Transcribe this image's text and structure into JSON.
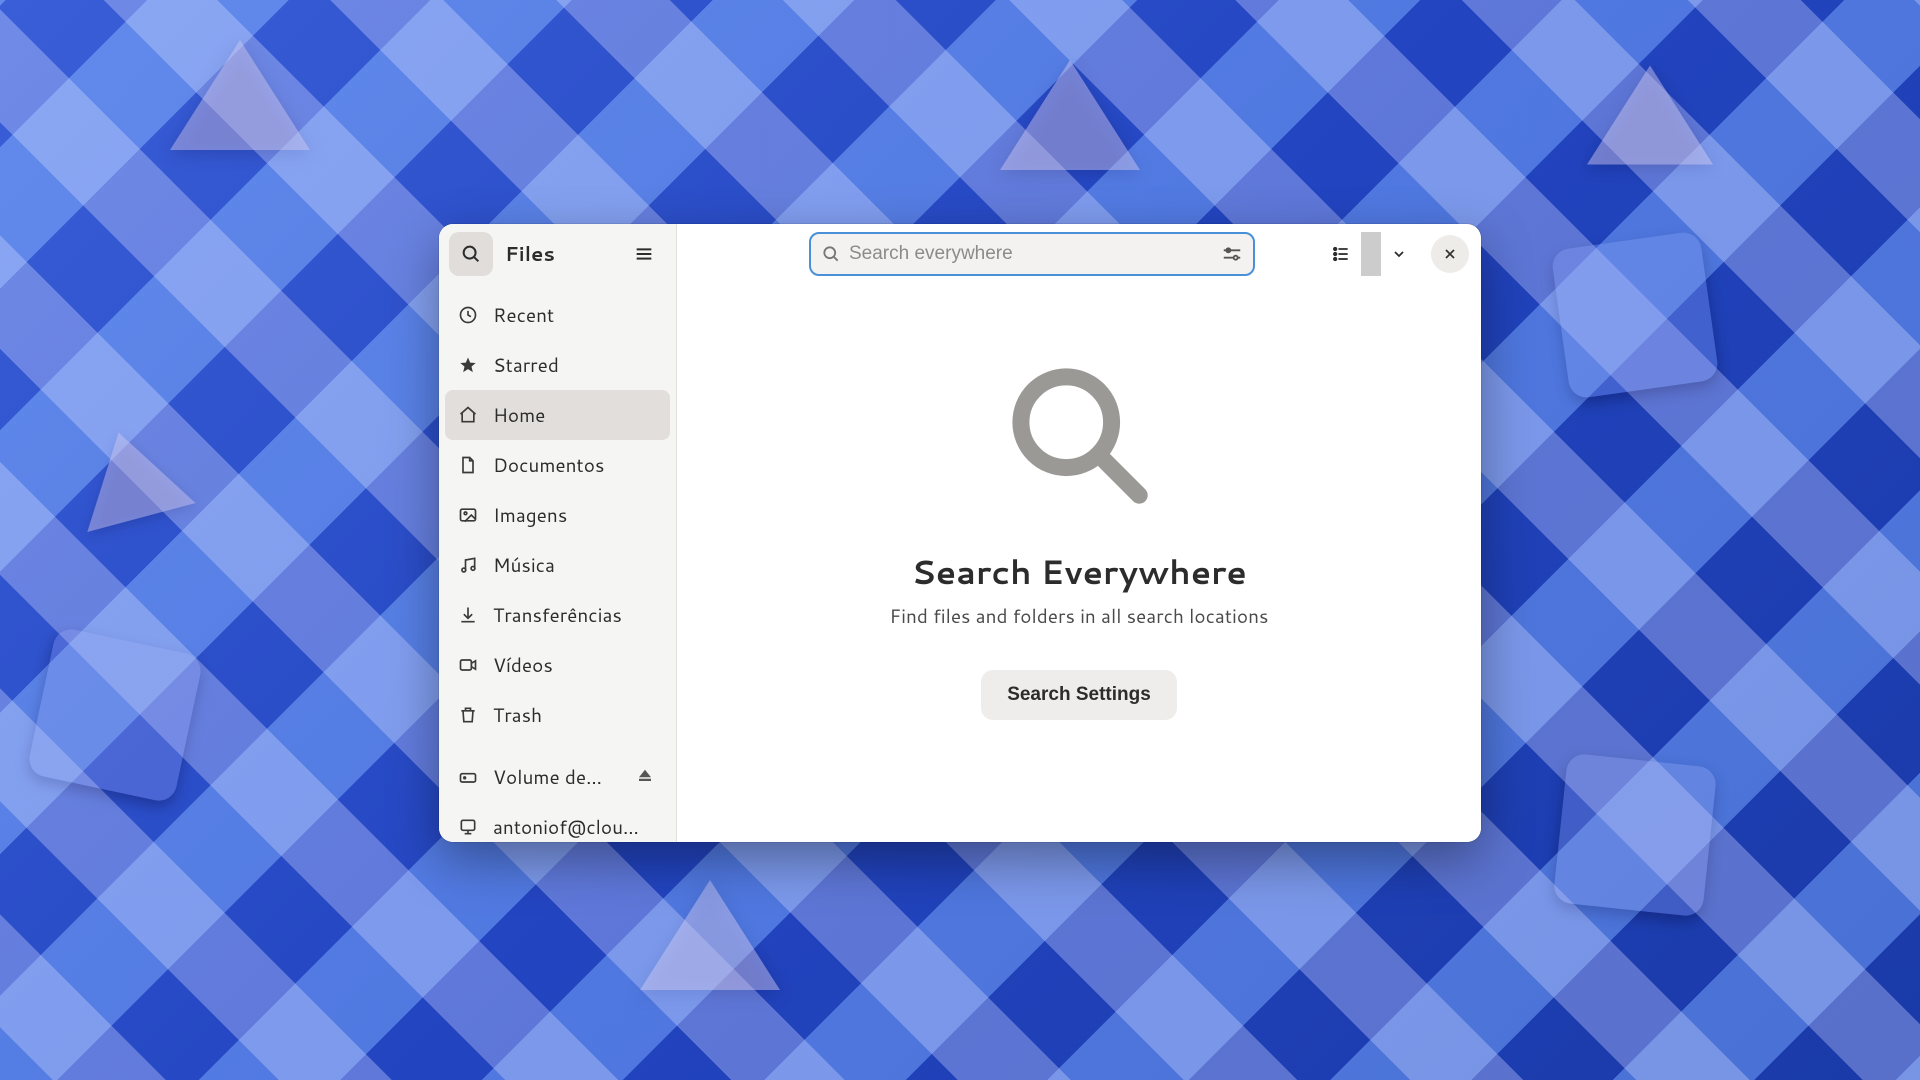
{
  "header": {
    "title": "Files",
    "search_placeholder": "Search everywhere"
  },
  "sidebar": {
    "items": [
      {
        "label": "Recent",
        "icon": "clock-icon",
        "selected": false
      },
      {
        "label": "Starred",
        "icon": "star-icon",
        "selected": false
      },
      {
        "label": "Home",
        "icon": "home-icon",
        "selected": true
      },
      {
        "label": "Documentos",
        "icon": "document-icon",
        "selected": false
      },
      {
        "label": "Imagens",
        "icon": "image-icon",
        "selected": false
      },
      {
        "label": "Música",
        "icon": "music-icon",
        "selected": false
      },
      {
        "label": "Transferências",
        "icon": "download-icon",
        "selected": false
      },
      {
        "label": "Vídeos",
        "icon": "video-icon",
        "selected": false
      },
      {
        "label": "Trash",
        "icon": "trash-icon",
        "selected": false
      }
    ],
    "mounts": [
      {
        "label": "Volume de…",
        "icon": "drive-icon",
        "ejectable": true
      },
      {
        "label": "antoniof@clou…",
        "icon": "network-icon",
        "ejectable": false
      }
    ]
  },
  "main": {
    "heading": "Search Everywhere",
    "subheading": "Find files and folders in all search locations",
    "button_label": "Search Settings"
  },
  "colors": {
    "accent": "#4a90d9",
    "sidebar_bg": "#f5f5f4",
    "selected_bg": "#e1dedb"
  }
}
